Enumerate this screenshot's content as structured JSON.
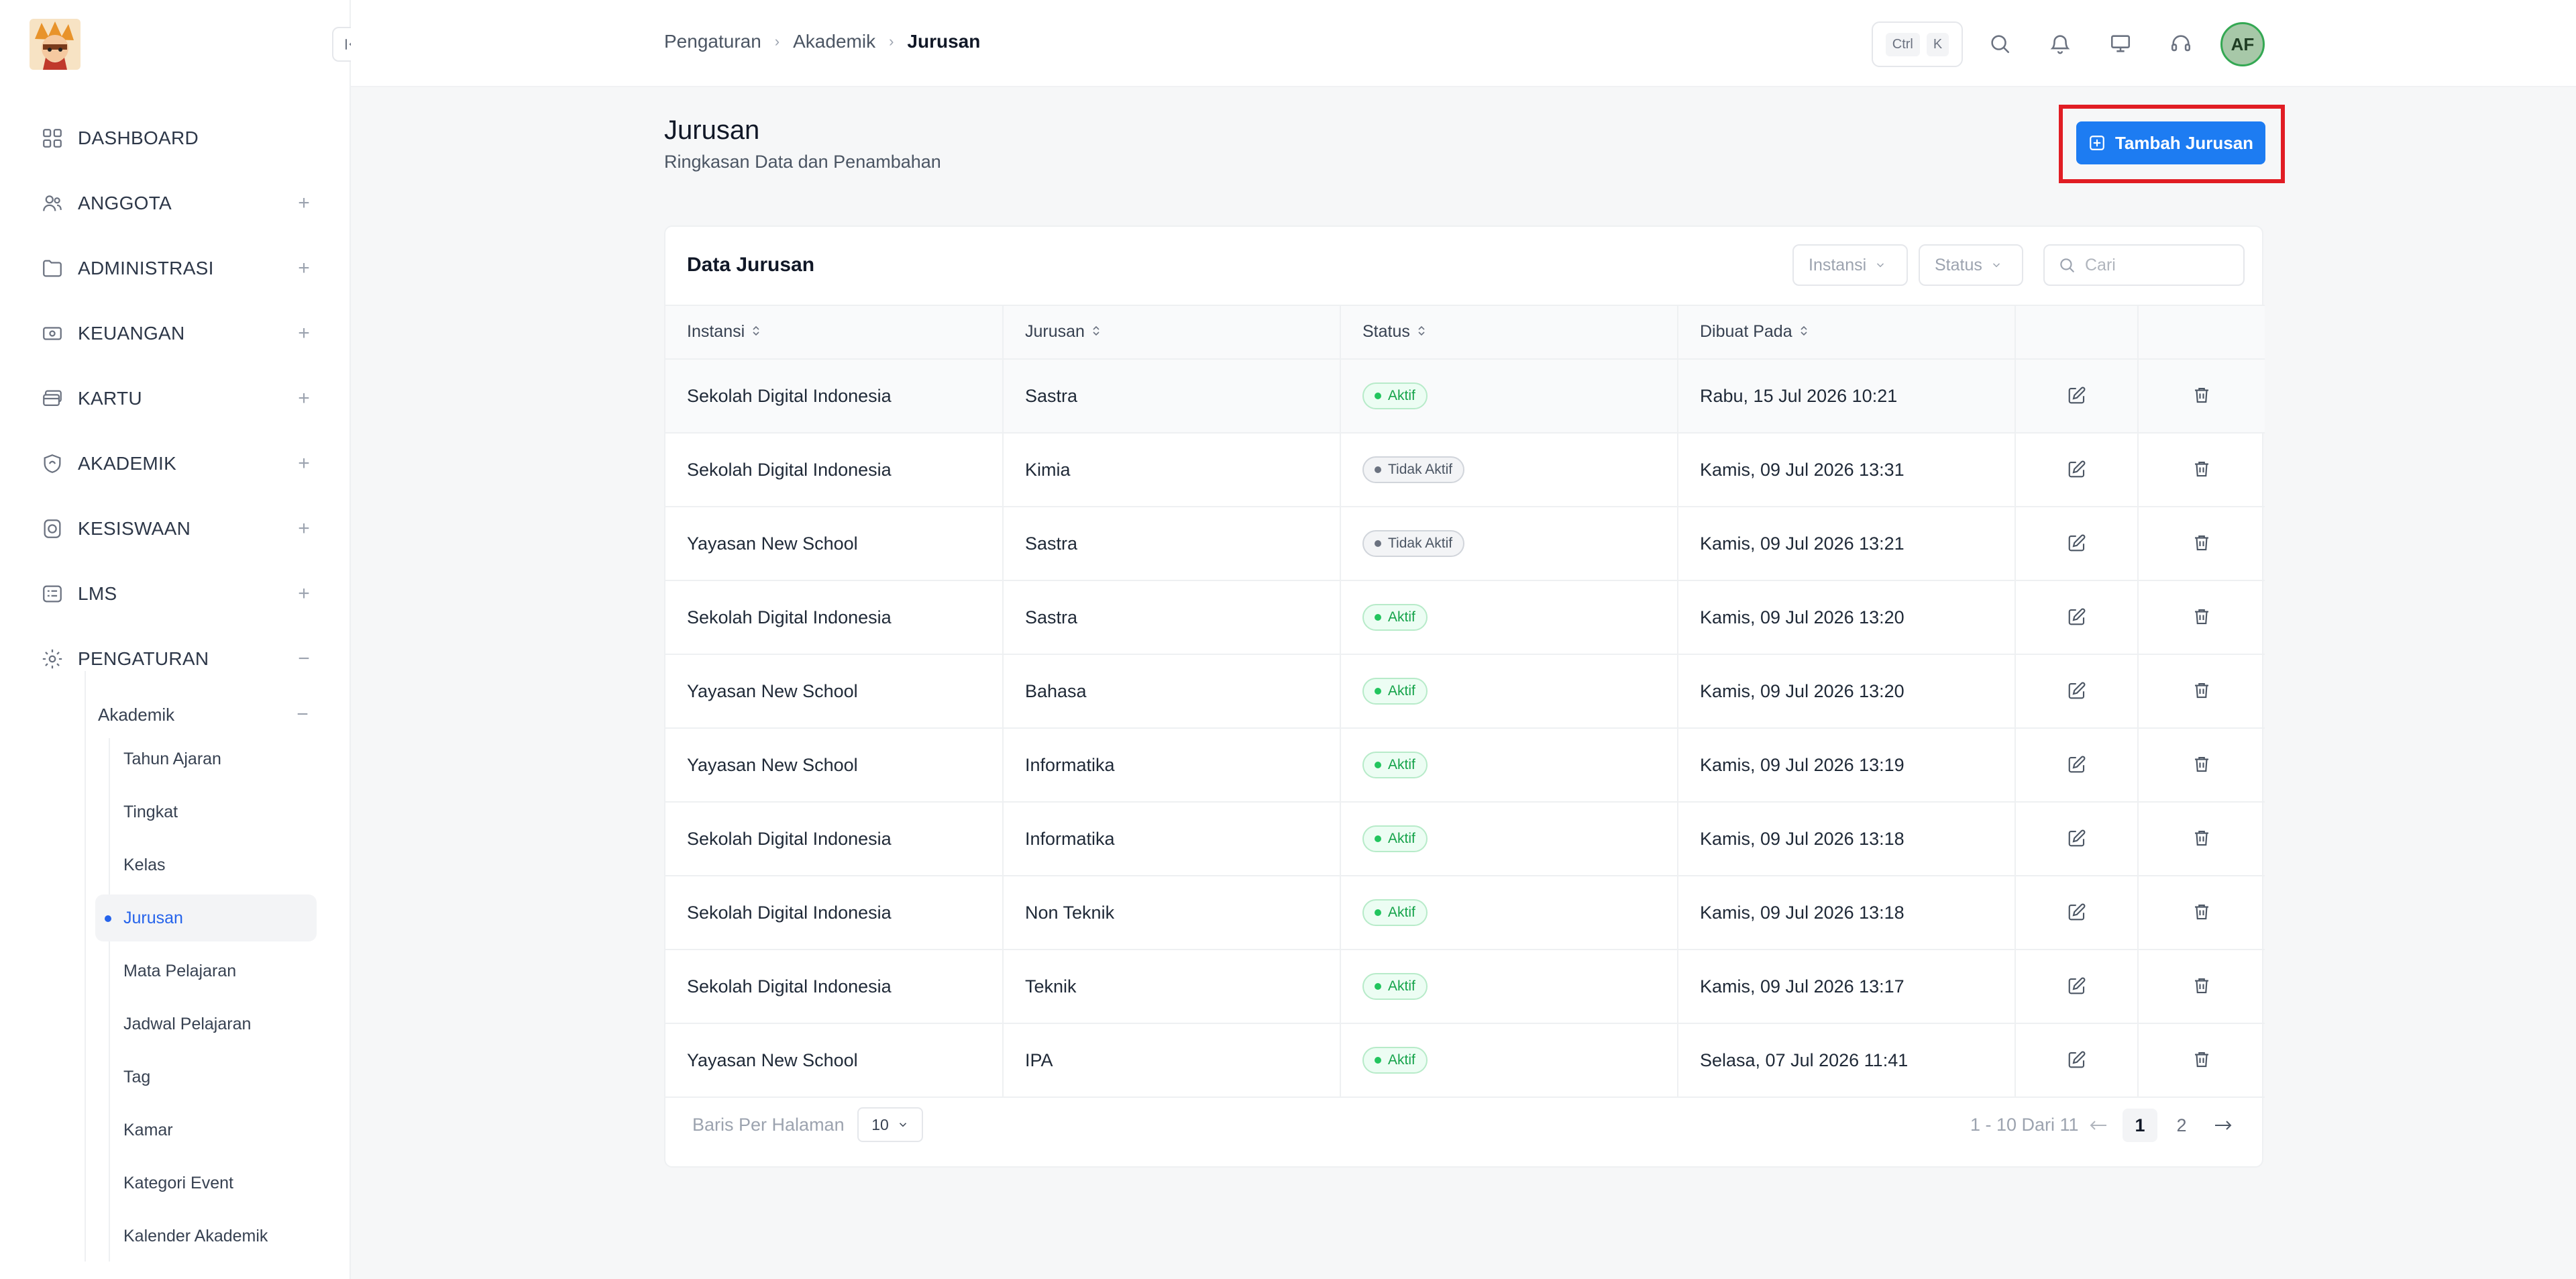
{
  "sidebar": {
    "items": [
      {
        "label": "DASHBOARD",
        "icon": "dashboard-icon",
        "toggle": ""
      },
      {
        "label": "ANGGOTA",
        "icon": "users-icon",
        "toggle": "+"
      },
      {
        "label": "ADMINISTRASI",
        "icon": "folder-icon",
        "toggle": "+"
      },
      {
        "label": "KEUANGAN",
        "icon": "money-icon",
        "toggle": "+"
      },
      {
        "label": "KARTU",
        "icon": "cards-icon",
        "toggle": "+"
      },
      {
        "label": "AKADEMIK",
        "icon": "academic-icon",
        "toggle": "+"
      },
      {
        "label": "KESISWAAN",
        "icon": "student-icon",
        "toggle": "+"
      },
      {
        "label": "LMS",
        "icon": "lms-icon",
        "toggle": "+"
      },
      {
        "label": "PENGATURAN",
        "icon": "gear-icon",
        "toggle": "−"
      }
    ],
    "sub_group": {
      "label": "Akademik",
      "toggle": "−"
    },
    "sub_items": [
      {
        "label": "Tahun Ajaran",
        "active": false
      },
      {
        "label": "Tingkat",
        "active": false
      },
      {
        "label": "Kelas",
        "active": false
      },
      {
        "label": "Jurusan",
        "active": true
      },
      {
        "label": "Mata Pelajaran",
        "active": false
      },
      {
        "label": "Jadwal Pelajaran",
        "active": false
      },
      {
        "label": "Tag",
        "active": false
      },
      {
        "label": "Kamar",
        "active": false
      },
      {
        "label": "Kategori Event",
        "active": false
      },
      {
        "label": "Kalender Akademik",
        "active": false
      }
    ]
  },
  "topbar": {
    "breadcrumb": [
      "Pengaturan",
      "Akademik",
      "Jurusan"
    ],
    "shortcut_keys": [
      "Ctrl",
      "K"
    ],
    "avatar_initials": "AF"
  },
  "page": {
    "title": "Jurusan",
    "subtitle": "Ringkasan Data dan Penambahan",
    "add_button": "Tambah Jurusan"
  },
  "card": {
    "title": "Data Jurusan",
    "filters": [
      "Instansi",
      "Status"
    ],
    "search_placeholder": "Cari"
  },
  "table": {
    "columns": [
      "Instansi",
      "Jurusan",
      "Status",
      "Dibuat Pada"
    ],
    "rows": [
      {
        "instansi": "Sekolah Digital Indonesia",
        "jurusan": "Sastra",
        "status": "Aktif",
        "dibuat": "Rabu, 15 Jul 2026 10:21"
      },
      {
        "instansi": "Sekolah Digital Indonesia",
        "jurusan": "Kimia",
        "status": "Tidak Aktif",
        "dibuat": "Kamis, 09 Jul 2026 13:31"
      },
      {
        "instansi": "Yayasan New School",
        "jurusan": "Sastra",
        "status": "Tidak Aktif",
        "dibuat": "Kamis, 09 Jul 2026 13:21"
      },
      {
        "instansi": "Sekolah Digital Indonesia",
        "jurusan": "Sastra",
        "status": "Aktif",
        "dibuat": "Kamis, 09 Jul 2026 13:20"
      },
      {
        "instansi": "Yayasan New School",
        "jurusan": "Bahasa",
        "status": "Aktif",
        "dibuat": "Kamis, 09 Jul 2026 13:20"
      },
      {
        "instansi": "Yayasan New School",
        "jurusan": "Informatika",
        "status": "Aktif",
        "dibuat": "Kamis, 09 Jul 2026 13:19"
      },
      {
        "instansi": "Sekolah Digital Indonesia",
        "jurusan": "Informatika",
        "status": "Aktif",
        "dibuat": "Kamis, 09 Jul 2026 13:18"
      },
      {
        "instansi": "Sekolah Digital Indonesia",
        "jurusan": "Non Teknik",
        "status": "Aktif",
        "dibuat": "Kamis, 09 Jul 2026 13:18"
      },
      {
        "instansi": "Sekolah Digital Indonesia",
        "jurusan": "Teknik",
        "status": "Aktif",
        "dibuat": "Kamis, 09 Jul 2026 13:17"
      },
      {
        "instansi": "Yayasan New School",
        "jurusan": "IPA",
        "status": "Aktif",
        "dibuat": "Selasa, 07 Jul 2026 11:41"
      }
    ]
  },
  "pagination": {
    "rows_label": "Baris Per Halaman",
    "rows_value": "10",
    "range": "1 - 10 Dari 11",
    "pages": [
      "1",
      "2"
    ],
    "current_page": "1"
  },
  "colors": {
    "primary": "#1d7cf2",
    "highlight": "#e11d24",
    "active_text": "#2563eb",
    "status_active": "#15a34a"
  }
}
